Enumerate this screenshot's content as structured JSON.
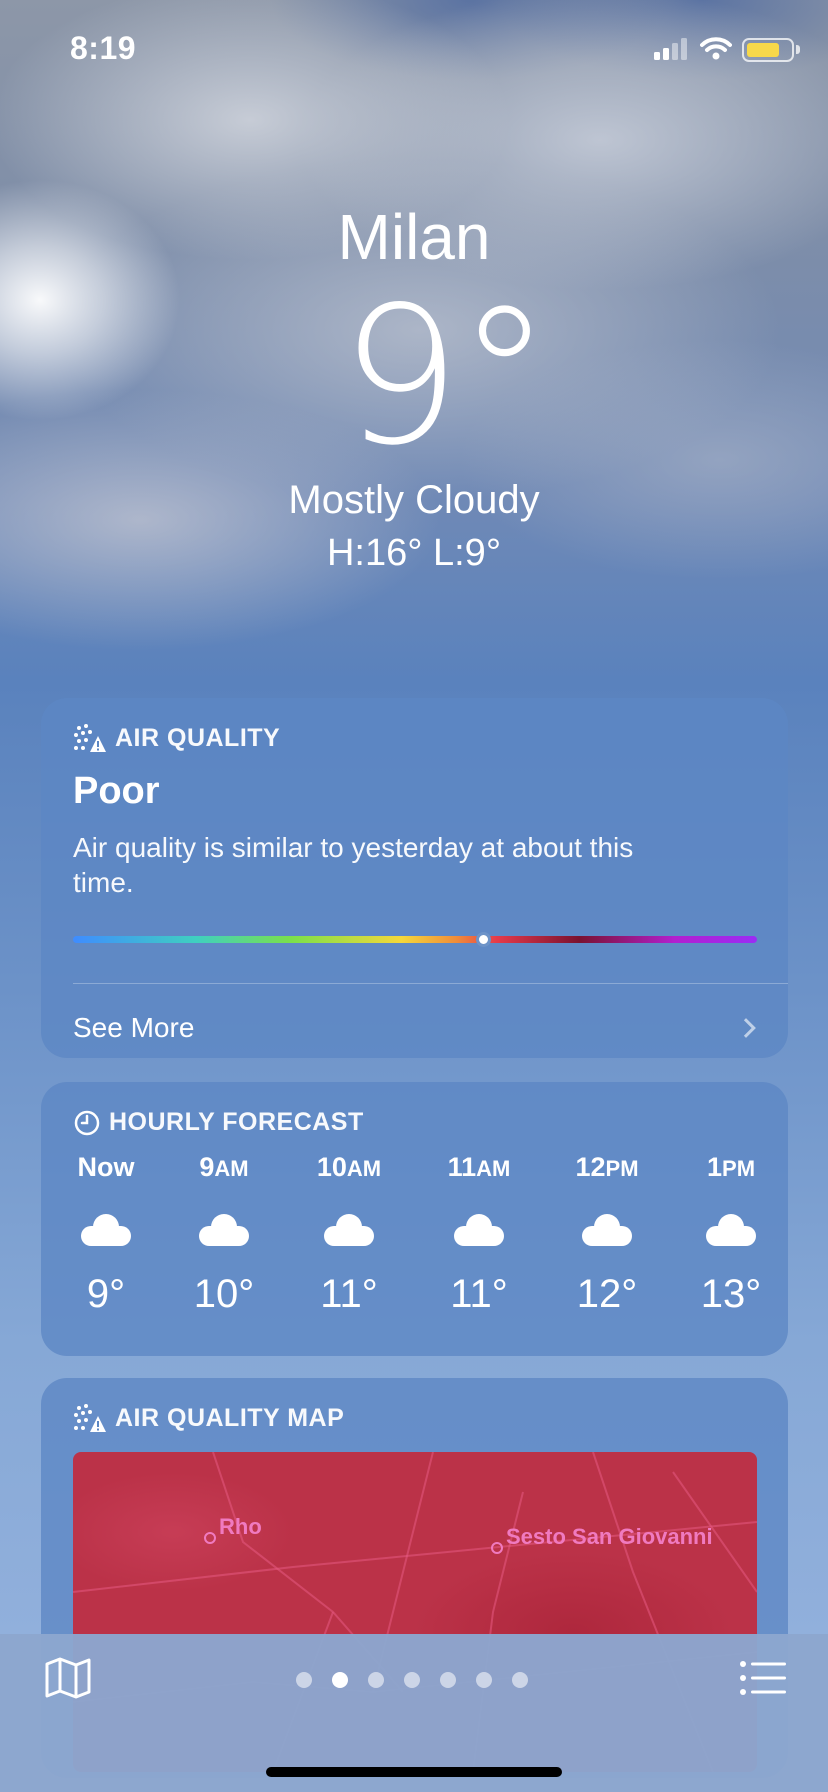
{
  "status_bar": {
    "time": "8:19",
    "battery_level": 0.72,
    "battery_color": "#f7d84a"
  },
  "weather": {
    "city": "Milan",
    "temperature": "9°",
    "condition": "Mostly Cloudy",
    "high_low": "H:16°  L:9°"
  },
  "air_quality": {
    "title": "AIR QUALITY",
    "level": "Poor",
    "description": "Air quality is similar to yesterday at about this time.",
    "scale_position": 0.6,
    "see_more": "See More"
  },
  "hourly_forecast": {
    "title": "HOURLY FORECAST",
    "hours": [
      {
        "time": "Now",
        "suffix": "",
        "icon": "cloud-icon",
        "temp": "9°"
      },
      {
        "time": "9",
        "suffix": "AM",
        "icon": "cloud-icon",
        "temp": "10°"
      },
      {
        "time": "10",
        "suffix": "AM",
        "icon": "cloud-icon",
        "temp": "11°"
      },
      {
        "time": "11",
        "suffix": "AM",
        "icon": "cloud-icon",
        "temp": "11°"
      },
      {
        "time": "12",
        "suffix": "PM",
        "icon": "cloud-icon",
        "temp": "12°"
      },
      {
        "time": "1",
        "suffix": "PM",
        "icon": "cloud-icon",
        "temp": "13°"
      }
    ]
  },
  "air_quality_map": {
    "title": "AIR QUALITY MAP",
    "places": [
      "Rho",
      "Sesto San Giovanni"
    ]
  },
  "page_indicator": {
    "count": 7,
    "active_index": 1
  },
  "bottom_bar": {
    "map_icon": "map-icon",
    "list_icon": "list-icon"
  }
}
